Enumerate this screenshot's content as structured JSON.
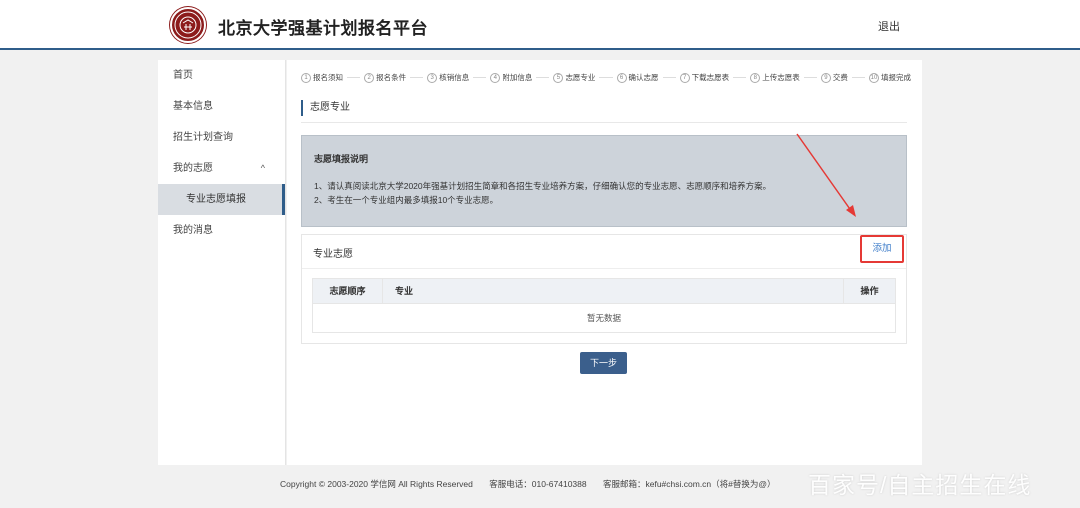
{
  "header": {
    "site_title": "北京大学强基计划报名平台",
    "logout_label": "退出",
    "logo_icon": "pku-seal-logo"
  },
  "sidebar": {
    "items": [
      {
        "label": "首页"
      },
      {
        "label": "基本信息"
      },
      {
        "label": "招生计划查询"
      },
      {
        "label": "我的志愿",
        "chevron": "^"
      },
      {
        "label": "专业志愿填报"
      },
      {
        "label": "我的消息"
      }
    ]
  },
  "steps": [
    {
      "num": "1",
      "label": "报名须知"
    },
    {
      "num": "2",
      "label": "报名条件"
    },
    {
      "num": "3",
      "label": "核销信息"
    },
    {
      "num": "4",
      "label": "附加信息"
    },
    {
      "num": "5",
      "label": "志愿专业"
    },
    {
      "num": "6",
      "label": "确认志愿"
    },
    {
      "num": "7",
      "label": "下载志愿表"
    },
    {
      "num": "8",
      "label": "上传志愿表"
    },
    {
      "num": "9",
      "label": "交费"
    },
    {
      "num": "10",
      "label": "填报完成"
    }
  ],
  "main": {
    "section_title": "志愿专业",
    "notice": {
      "title": "志愿填报说明",
      "lines": [
        "1、请认真阅读北京大学2020年强基计划招生简章和各招生专业培养方案，仔细确认您的专业志愿、志愿顺序和培养方案。",
        "2、考生在一个专业组内最多填报10个专业志愿。"
      ]
    },
    "favorites": {
      "title": "专业志愿",
      "add_label": "添加",
      "columns": [
        "志愿顺序",
        "专业",
        "操作"
      ],
      "empty_text": "暂无数据"
    },
    "next_label": "下一步"
  },
  "footer": {
    "copyright": "Copyright © 2003-2020 学信网 All Rights Reserved",
    "phone": "客服电话：010-67410388",
    "email": "客服邮箱：kefu#chsi.com.cn（将#替换为@）"
  },
  "watermark": "百家号/自主招生在线",
  "colors": {
    "accent": "#2f5d8a",
    "highlight": "#e53935",
    "link": "#3d7cc9",
    "notice_bg": "#cdd3da"
  }
}
